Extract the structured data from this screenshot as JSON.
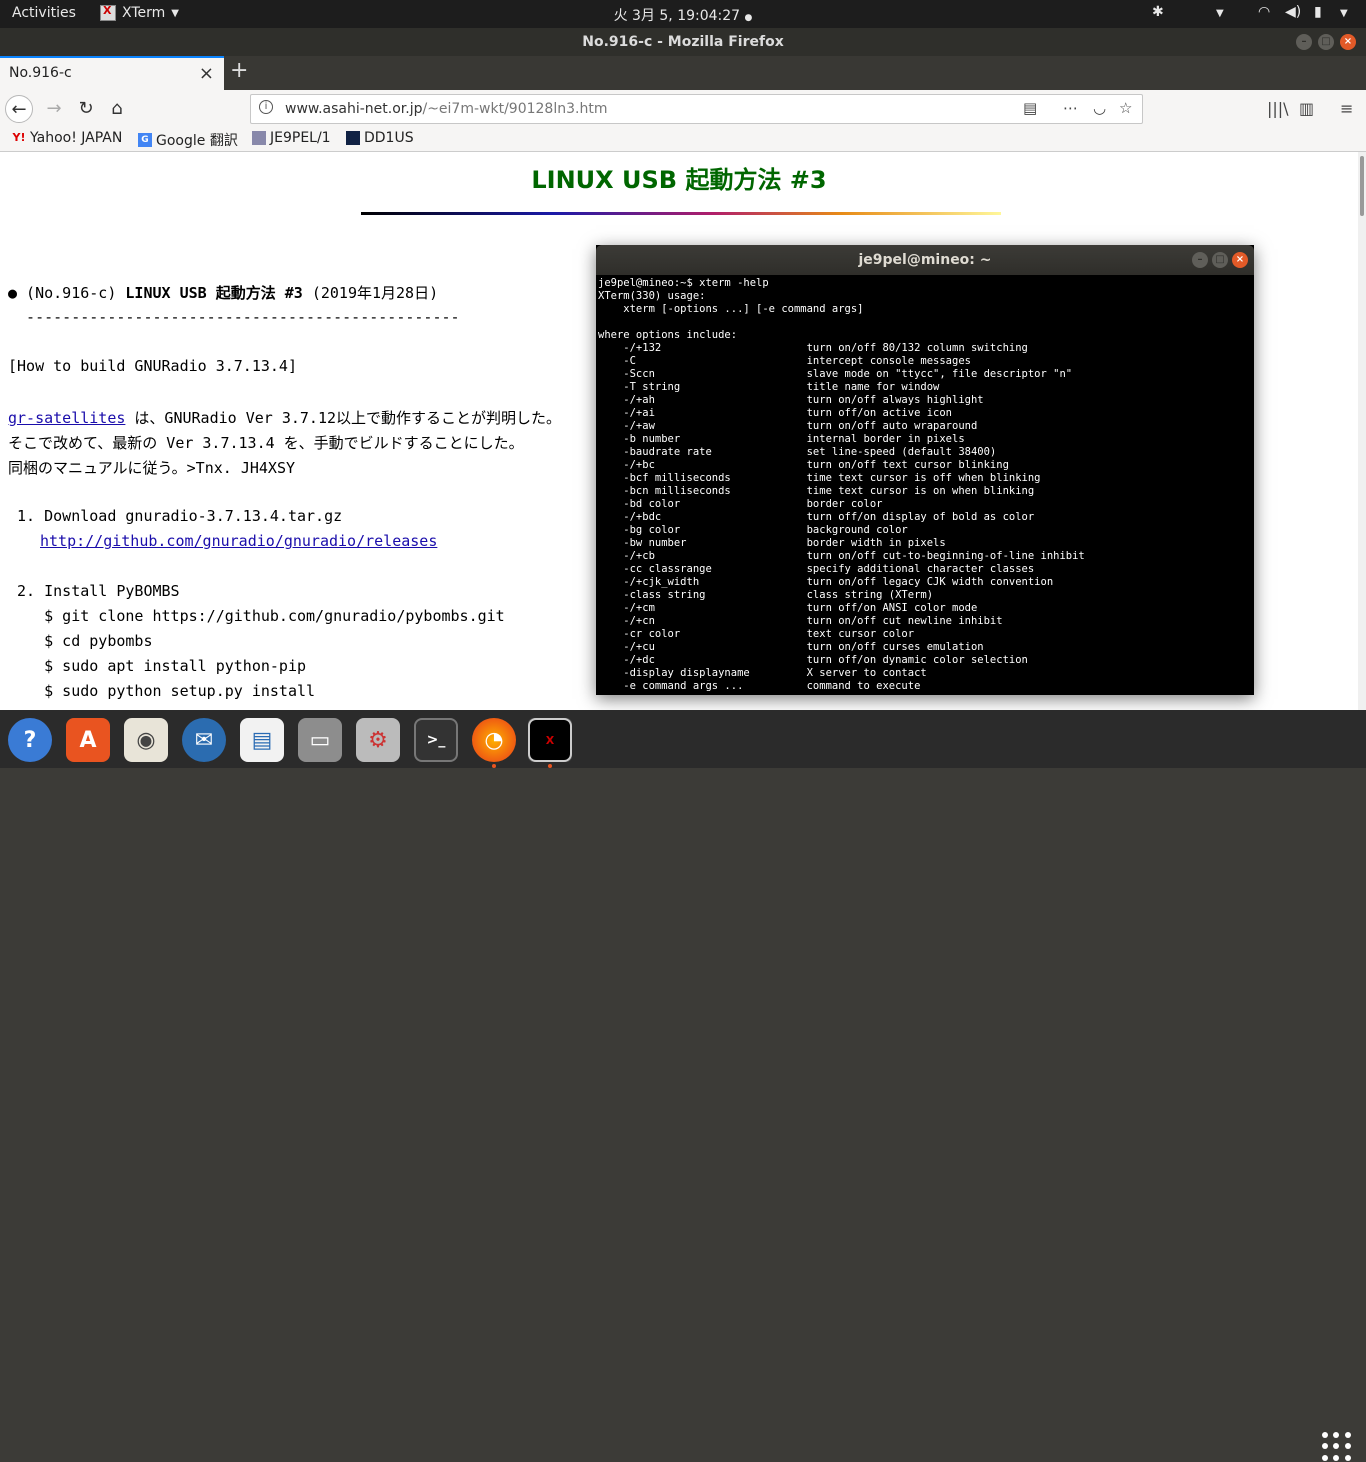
{
  "topbar": {
    "activities": "Activities",
    "app_name": "XTerm",
    "clock": "火  3月  5, 19:04:27"
  },
  "firefox": {
    "window_title": "No.916-c - Mozilla Firefox",
    "tab_title": "No.916-c",
    "url_host": "www.asahi-net.or.jp",
    "url_path": "/~ei7m-wkt/90128ln3.htm",
    "bookmarks": [
      "Yahoo! JAPAN",
      "Google 翻訳",
      "JE9PEL/1",
      "DD1US"
    ]
  },
  "page": {
    "title": "LINUX USB 起動方法 #3",
    "heading_prefix": "● (No.916-c) ",
    "heading_bold": "LINUX USB 起動方法 #3",
    "heading_suffix": " (2019年1月28日)",
    "underline": "  ------------------------------------------------",
    "build_title": "[How to build GNURadio 3.7.13.4]",
    "link_satellites": "gr-satellites",
    "para_line1_rest": " は、GNURadio Ver 3.7.12以上で動作することが判明した。",
    "para_line2": "そこで改めて、最新の Ver 3.7.13.4 を、手動でビルドすることにした。",
    "para_line3": "同梱のマニュアルに従う。>Tnx. JH4XSY",
    "step1": " 1. Download gnuradio-3.7.13.4.tar.gz",
    "step1_link": "http://github.com/gnuradio/gnuradio/releases",
    "step2": " 2. Install PyBOMBS",
    "cmd1": "    $ git clone https://github.com/gnuradio/pybombs.git",
    "cmd2": "    $ cd pybombs",
    "cmd3": "    $ sudo apt install python-pip",
    "cmd4": "    $ sudo python setup.py install"
  },
  "xterm": {
    "title": "je9pel@mineo: ~",
    "lines": [
      "je9pel@mineo:~$ xterm -help",
      "XTerm(330) usage:",
      "    xterm [-options ...] [-e command args]",
      "",
      "where options include:",
      "    -/+132                       turn on/off 80/132 column switching",
      "    -C                           intercept console messages",
      "    -Sccn                        slave mode on \"ttycc\", file descriptor \"n\"",
      "    -T string                    title name for window",
      "    -/+ah                        turn on/off always highlight",
      "    -/+ai                        turn off/on active icon",
      "    -/+aw                        turn on/off auto wraparound",
      "    -b number                    internal border in pixels",
      "    -baudrate rate               set line-speed (default 38400)",
      "    -/+bc                        turn on/off text cursor blinking",
      "    -bcf milliseconds            time text cursor is off when blinking",
      "    -bcn milliseconds            time text cursor is on when blinking",
      "    -bd color                    border color",
      "    -/+bdc                       turn off/on display of bold as color",
      "    -bg color                    background color",
      "    -bw number                   border width in pixels",
      "    -/+cb                        turn on/off cut-to-beginning-of-line inhibit",
      "    -cc classrange               specify additional character classes",
      "    -/+cjk_width                 turn on/off legacy CJK width convention",
      "    -class string                class string (XTerm)",
      "    -/+cm                        turn off/on ANSI color mode",
      "    -/+cn                        turn on/off cut newline inhibit",
      "    -cr color                    text cursor color",
      "    -/+cu                        turn on/off curses emulation",
      "    -/+dc                        turn off/on dynamic color selection",
      "    -display displayname         X server to contact",
      "    -e command args ...          command to execute"
    ]
  },
  "dock": [
    "help-icon",
    "software-center-icon",
    "rhythmbox-icon",
    "thunderbird-icon",
    "writer-icon",
    "files-icon",
    "settings-icon",
    "terminal-icon",
    "firefox-icon",
    "xterm-icon"
  ]
}
